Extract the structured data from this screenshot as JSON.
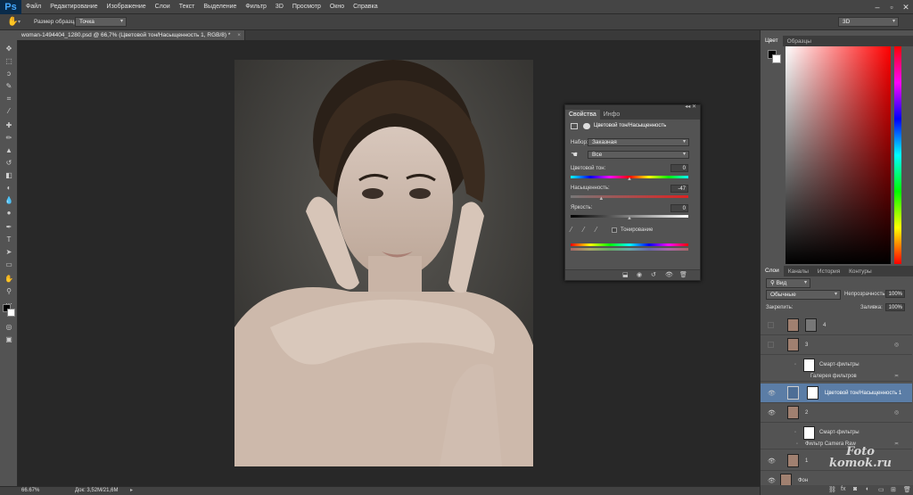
{
  "app": {
    "logo": "Ps"
  },
  "menu": [
    "Файл",
    "Редактирование",
    "Изображение",
    "Слои",
    "Текст",
    "Выделение",
    "Фильтр",
    "3D",
    "Просмотр",
    "Окно",
    "Справка"
  ],
  "options": {
    "sample_label": "Размер образца:",
    "sample_value": "Точка",
    "workspace": "3D"
  },
  "document_tab": {
    "title": "woman-1494404_1280.psd @ 66,7% (Цветовой тон/Насыщенность 1, RGB/8) *"
  },
  "status": {
    "zoom": "66.67%",
    "doc": "Док: 3,52M/21,6M"
  },
  "color_panel": {
    "tabs": [
      "Цвет",
      "Образцы"
    ]
  },
  "properties": {
    "tabs": [
      "Свойства",
      "Инфо"
    ],
    "title": "Цветовой тон/Насыщенность",
    "preset_label": "Набор:",
    "preset_value": "Заказная",
    "channel_value": "Все",
    "hue_label": "Цветовой тон:",
    "hue_value": "0",
    "hue_position": 0.5,
    "sat_label": "Насыщенность:",
    "sat_value": "-47",
    "sat_position": 0.26,
    "light_label": "Яркость:",
    "light_value": "0",
    "light_position": 0.5,
    "colorize_label": "Тонирование"
  },
  "layers_panel": {
    "tabs": [
      "Слои",
      "Каналы",
      "История",
      "Контуры"
    ],
    "filter": "Вид",
    "blend": "Обычные",
    "opacity_label": "Непрозрачность:",
    "opacity_value": "100%",
    "lock_label": "Закрепить:",
    "fill_label": "Заливка:",
    "fill_value": "100%",
    "layers": [
      {
        "name": "4"
      },
      {
        "name": "3"
      },
      {
        "name": "Смарт-фильтры"
      },
      {
        "name": "Галерея фильтров"
      },
      {
        "name": "Цветовой тон/Насыщенность 1"
      },
      {
        "name": "2"
      },
      {
        "name": "Смарт-фильтры"
      },
      {
        "name": "Фильтр Camera Raw"
      },
      {
        "name": "1"
      },
      {
        "name": "Фон"
      }
    ]
  },
  "watermark": {
    "line1": "Foto",
    "line2": "komok.ru"
  },
  "colors": {
    "accent": "#5b7da6",
    "ps_blue": "#46a9ff"
  }
}
